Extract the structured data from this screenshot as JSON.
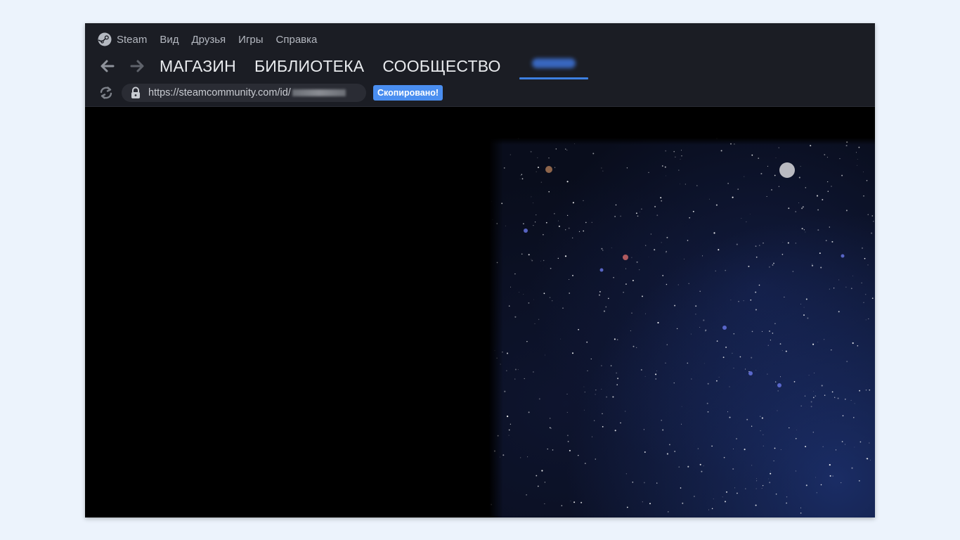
{
  "menubar": {
    "brand": "Steam",
    "items": [
      "Вид",
      "Друзья",
      "Игры",
      "Справка"
    ]
  },
  "nav": {
    "tabs": [
      "МАГАЗИН",
      "БИБЛИОТЕКА",
      "СООБЩЕСТВО"
    ],
    "active_tab_label_redacted": true,
    "icons": [
      "back-arrow-icon",
      "forward-arrow-icon"
    ]
  },
  "address": {
    "url": "https://steamcommunity.com/id/",
    "url_suffix_redacted": true,
    "copied_badge": "Скопировано!",
    "icons": [
      "reload-icon",
      "lock-icon"
    ]
  },
  "colors": {
    "chrome_bg": "#1b1d24",
    "accent": "#3d7fe0",
    "badge_bg": "#4a8ef0",
    "page_bg": "#000000",
    "outer_bg": "#ecf3fc"
  },
  "content": {
    "background": "starfield"
  }
}
